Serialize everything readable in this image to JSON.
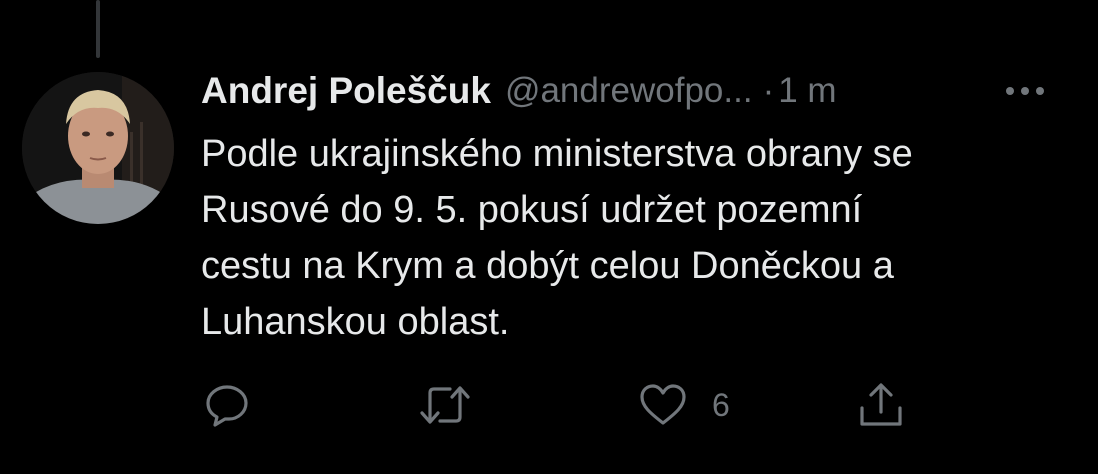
{
  "tweet": {
    "author_name": "Andrej Poleščuk",
    "handle": "@andrewofpo...",
    "separator": "·",
    "time": "1 m",
    "text_lines": [
      "Podle ukrajinského ministerstva obrany se",
      "Rusové do 9. 5. pokusí udržet pozemní",
      "cestu na Krym a dobýt celou Doněckou a",
      "Luhanskou oblast."
    ]
  },
  "actions": {
    "reply_icon": "reply-icon",
    "retweet_icon": "retweet-icon",
    "like_icon": "heart-icon",
    "like_count": "6",
    "share_icon": "share-icon"
  },
  "colors": {
    "background": "#000000",
    "primary_text": "#e7e9ea",
    "secondary_text": "#71767b",
    "thread_line": "#333639"
  }
}
